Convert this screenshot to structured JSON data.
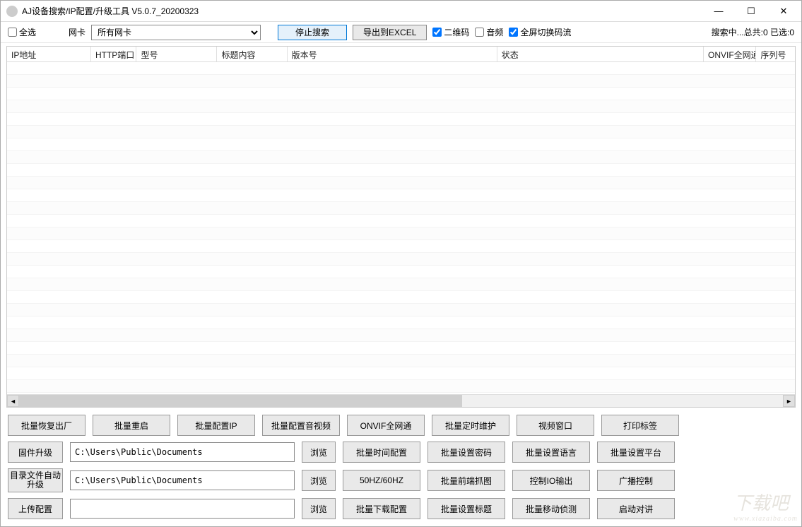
{
  "window": {
    "title": "AJ设备搜索/IP配置/升级工具 V5.0.7_20200323"
  },
  "toolbar": {
    "selectAll": "全选",
    "nicLabel": "网卡",
    "nicValue": "所有网卡",
    "stopSearch": "停止搜索",
    "exportExcel": "导出到EXCEL",
    "qrCode": "二维码",
    "audio": "音频",
    "fullscreenSwitch": "全屏切换码流",
    "status": "搜索中...总共:0 已选:0"
  },
  "columns": {
    "ip": "IP地址",
    "httpPort": "HTTP端口",
    "model": "型号",
    "title": "标题内容",
    "version": "版本号",
    "state": "状态",
    "onvif": "ONVIF全网通",
    "serial": "序列号"
  },
  "buttons": {
    "row1": {
      "restoreFactory": "批量恢复出厂",
      "reboot": "批量重启",
      "configIP": "批量配置IP",
      "configAV": "批量配置音视频",
      "onvif": "ONVIF全网通",
      "schedMaint": "批量定时维护",
      "videoWin": "视频窗口",
      "printLabel": "打印标签"
    },
    "row2": {
      "fwUpgrade": "固件升级",
      "path1": "C:\\Users\\Public\\Documents",
      "browse1": "浏览",
      "timeConfig": "批量时间配置",
      "setPwd": "批量设置密码",
      "setLang": "批量设置语言",
      "setPlatform": "批量设置平台"
    },
    "row3": {
      "dirAutoUpgrade": "目录文件自动升级",
      "path2": "C:\\Users\\Public\\Documents",
      "browse2": "浏览",
      "hz": "50HZ/60HZ",
      "frontSnap": "批量前端抓图",
      "ioOut": "控制IO输出",
      "broadcast": "广播控制"
    },
    "row4": {
      "uploadCfg": "上传配置",
      "path3": "",
      "browse3": "浏览",
      "downloadCfg": "批量下载配置",
      "setTitle": "批量设置标题",
      "motionDet": "批量移动侦测",
      "startTalk": "启动对讲"
    }
  },
  "watermark": {
    "main": "下载吧",
    "sub": "www.xiazaiba.com"
  }
}
